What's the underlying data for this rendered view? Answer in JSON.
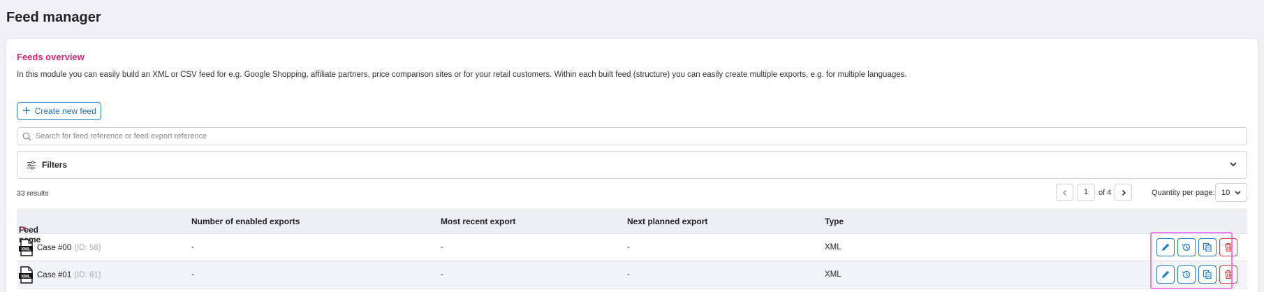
{
  "page": {
    "title": "Feed manager"
  },
  "overview": {
    "title": "Feeds overview",
    "intro": "In this module you can easily build an XML or CSV feed for e.g. Google Shopping, affiliate partners, price comparison sites or for your retail customers. Within each built feed (structure) you can easily create multiple exports, e.g. for multiple languages."
  },
  "toolbar": {
    "create_label": "Create new feed",
    "create_icon": "plus-icon"
  },
  "search": {
    "placeholder": "Search for feed reference or feed export reference",
    "value": ""
  },
  "filters": {
    "label": "Filters"
  },
  "results": {
    "count_text": "33 results"
  },
  "pagination": {
    "current": "1",
    "of_text": "of 4",
    "qty_label": "Quantity per page:",
    "qty_value": "10"
  },
  "table": {
    "columns": [
      "Feed name",
      "Number of enabled exports",
      "Most recent export",
      "Next planned export",
      "Type"
    ],
    "rows": [
      {
        "name": "Case #00",
        "id": "(ID: 58)",
        "enabled_exports": "-",
        "recent": "-",
        "next": "-",
        "type": "XML",
        "icon": "xml-file-icon"
      },
      {
        "name": "Case #01",
        "id": "(ID: 61)",
        "enabled_exports": "-",
        "recent": "-",
        "next": "-",
        "type": "XML",
        "icon": "xml-file-icon"
      }
    ]
  },
  "colors": {
    "accent": "#d6246e",
    "primary": "#1f7bc7",
    "danger": "#d9363e",
    "highlight": "#f07cf0"
  }
}
